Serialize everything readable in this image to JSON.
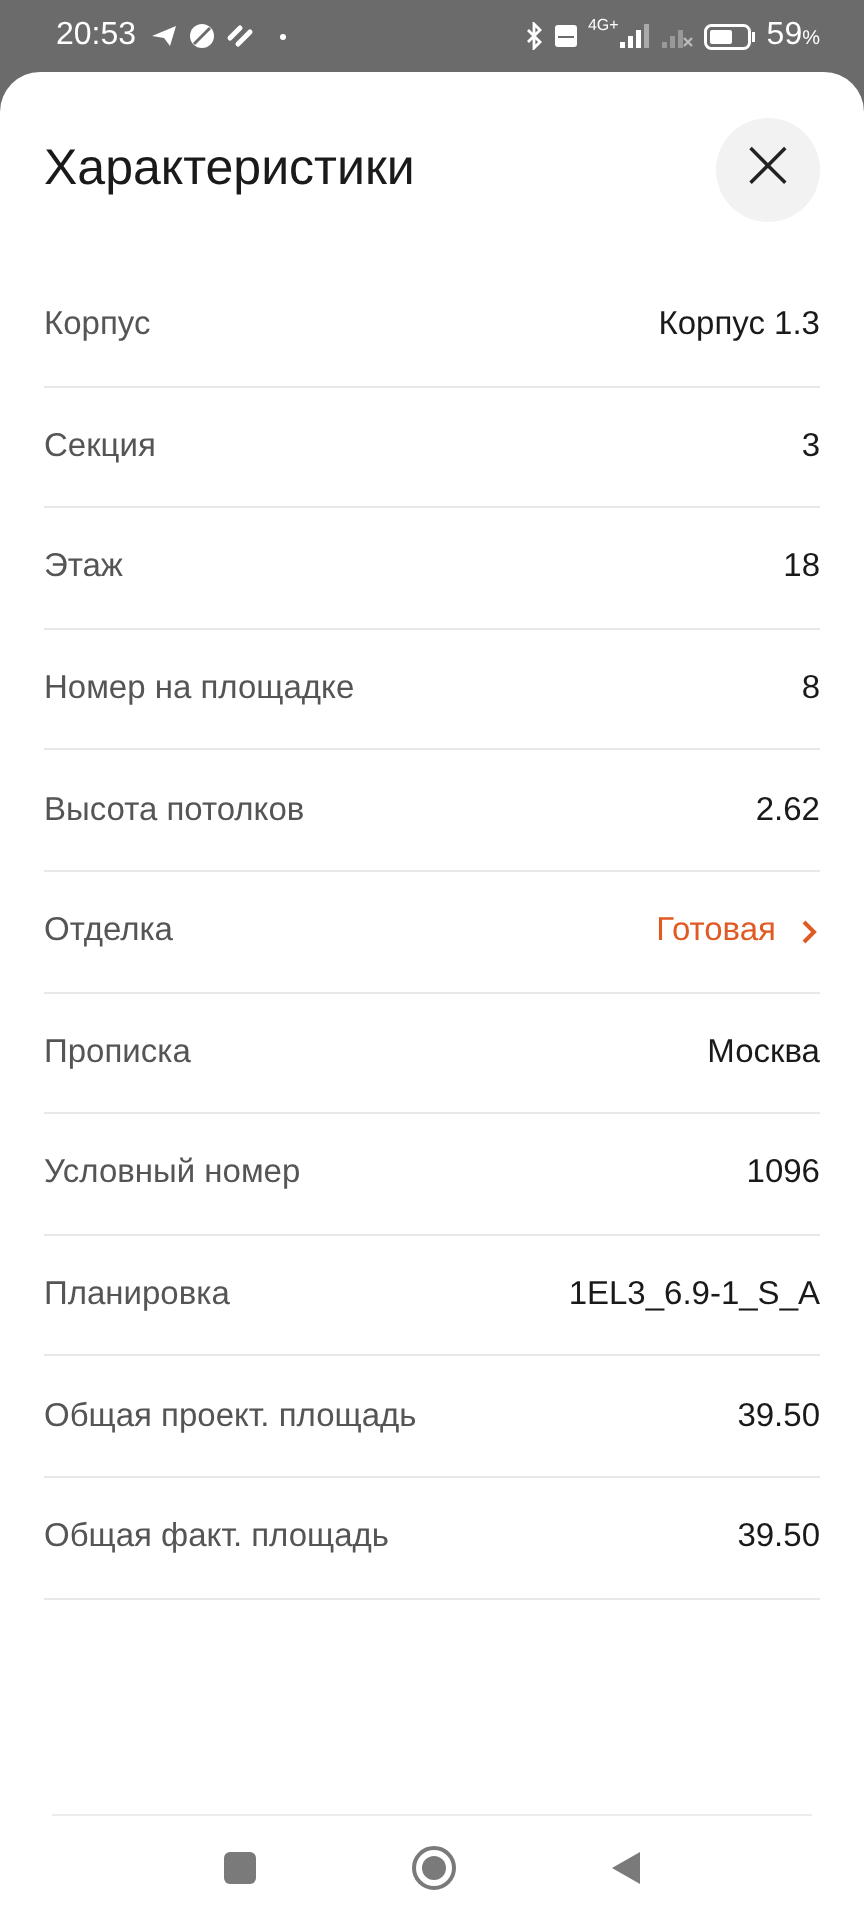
{
  "status_bar": {
    "time": "20:53",
    "network": "4G+",
    "battery": "59",
    "battery_unit": "%"
  },
  "sheet": {
    "title": "Характеристики",
    "close_icon": "×"
  },
  "rows": [
    {
      "kind": "text",
      "label": "Корпус",
      "value": "Корпус 1.3"
    },
    {
      "kind": "text",
      "label": "Секция",
      "value": "3"
    },
    {
      "kind": "text",
      "label": "Этаж",
      "value": "18"
    },
    {
      "kind": "text",
      "label": "Номер на площадке",
      "value": "8"
    },
    {
      "kind": "text",
      "label": "Высота потолков",
      "value": "2.62"
    },
    {
      "kind": "link",
      "label": "Отделка",
      "value": "Готовая"
    },
    {
      "kind": "text",
      "label": "Прописка",
      "value": "Москва"
    },
    {
      "kind": "text",
      "label": "Условный номер",
      "value": "1096"
    },
    {
      "kind": "text",
      "label": "Планировка",
      "value": "1EL3_6.9-1_S_A"
    },
    {
      "kind": "text",
      "label": "Общая проект. площадь",
      "value": "39.50"
    },
    {
      "kind": "text",
      "label": "Общая факт. площадь",
      "value": "39.50"
    }
  ]
}
